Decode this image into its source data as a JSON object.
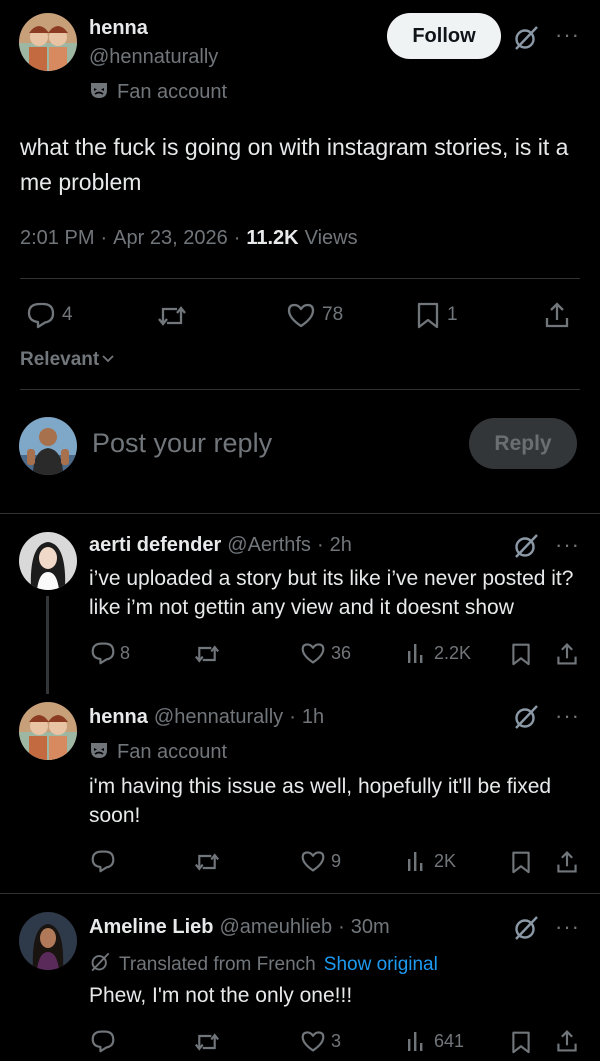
{
  "main_post": {
    "author_name": "henna",
    "author_handle": "@hennaturally",
    "badge_label": "Fan account",
    "follow_label": "Follow",
    "text": "what the fuck is going on with instagram stories, is it a me problem",
    "time": "2:01 PM",
    "sep": "·",
    "date": "Apr 23, 2026",
    "views_count": "11.2K",
    "views_label": "Views",
    "replies": "4",
    "likes": "78",
    "bookmarks": "1"
  },
  "sort_label": "Relevant",
  "composer": {
    "placeholder": "Post your reply",
    "reply_label": "Reply"
  },
  "replies": [
    {
      "name": "aerti defender",
      "handle": "@Aerthfs",
      "time": "2h",
      "text": "i’ve uploaded a story but its like i’ve never posted it? like i’m not gettin any view and it doesnt show",
      "replies": "8",
      "likes": "36",
      "views": "2.2K"
    },
    {
      "name": "henna",
      "handle": "@hennaturally",
      "time": "1h",
      "badge_label": "Fan account",
      "text": "i'm having this issue as well, hopefully it'll be fixed soon!",
      "likes": "9",
      "views": "2K"
    },
    {
      "name": "Ameline Lieb",
      "handle": "@ameuhlieb",
      "time": "30m",
      "translated_label": "Translated from French",
      "show_original_label": "Show original",
      "text": "Phew, I'm not the only one!!!",
      "likes": "3",
      "views": "641"
    }
  ],
  "colors": {
    "background": "#000000",
    "text": "#e7e9ea",
    "secondary": "#71767b",
    "link": "#1d9bf0",
    "divider": "#2f3336"
  }
}
